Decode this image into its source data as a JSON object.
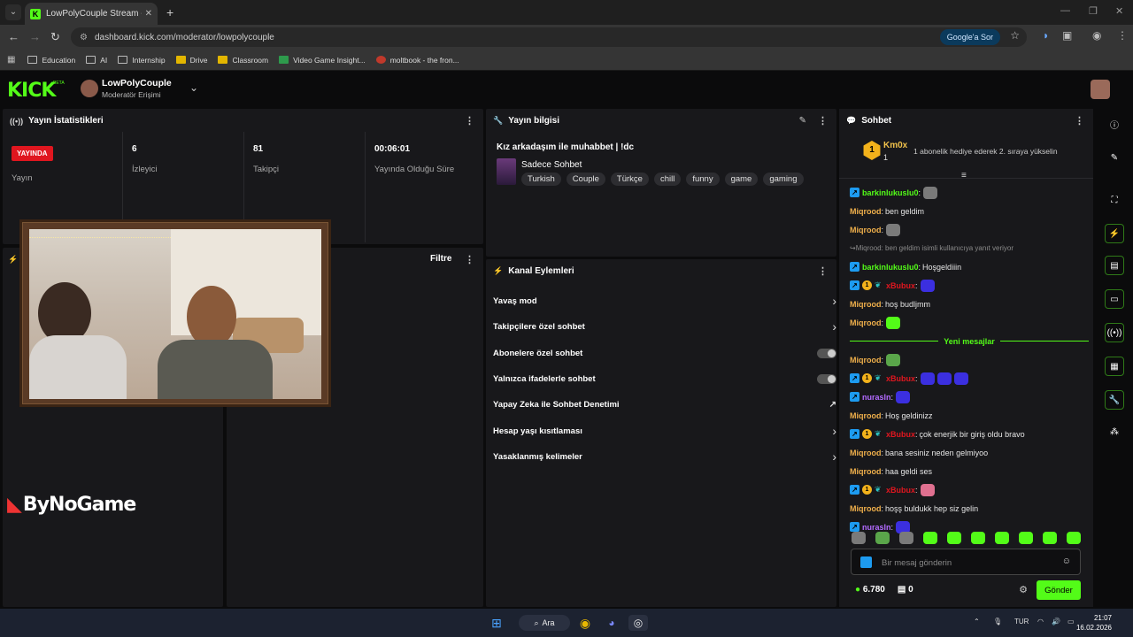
{
  "browser": {
    "tab_title": "LowPolyCouple Stream - Kick D",
    "url": "dashboard.kick.com/moderator/lowpolycouple",
    "google_button": "Google'a Sor",
    "bookmarks": [
      "Education",
      "AI",
      "Internship",
      "Drive",
      "Classroom",
      "Video Game Insight...",
      "moltbook - the fron..."
    ]
  },
  "site": {
    "logo": "KICK",
    "beta": "BETA",
    "channel_name": "LowPolyCouple",
    "channel_role": "Moderatör Erişimi"
  },
  "stats_panel": {
    "title": "Yayın İstatistikleri",
    "live_badge": "YAYINDA",
    "items": [
      {
        "label": "Yayın"
      },
      {
        "value": "6",
        "label": "İzleyici"
      },
      {
        "value": "81",
        "label": "Takipçi"
      },
      {
        "value": "00:06:01",
        "label": "Yayında Olduğu Süre"
      }
    ]
  },
  "activity_panel": {
    "filter": "Filtre"
  },
  "overlay": {
    "sponsor": "ByNoGame"
  },
  "info_panel": {
    "title": "Yayın bilgisi",
    "stream_title": "Kız arkadaşım ile muhabbet | !dc",
    "category": "Sadece Sohbet",
    "tags": [
      "Turkish",
      "Couple",
      "Türkçe",
      "chill",
      "funny",
      "game",
      "gaming"
    ]
  },
  "actions_panel": {
    "title": "Kanal Eylemleri",
    "items": [
      {
        "label": "Yavaş mod",
        "kind": "arrow"
      },
      {
        "label": "Takipçilere özel sohbet",
        "kind": "arrow"
      },
      {
        "label": "Abonelere özel sohbet",
        "kind": "toggle"
      },
      {
        "label": "Yalnızca ifadelerle sohbet",
        "kind": "toggle"
      },
      {
        "label": "Yapay Zeka ile Sohbet Denetimi",
        "kind": "external"
      },
      {
        "label": "Hesap yaşı kısıtlaması",
        "kind": "arrow"
      },
      {
        "label": "Yasaklanmış kelimeler",
        "kind": "arrow"
      }
    ]
  },
  "chat": {
    "title": "Sohbet",
    "highlight": {
      "rank": "1",
      "user": "Km0x",
      "count": "1",
      "message": "1 abonelik hediye ederek 2. sıraya yükselin"
    },
    "messages": [
      {
        "user": "barkinlukuslu0",
        "color": "#53fc18",
        "badges": [
          "kick"
        ],
        "text": "",
        "emotes": [
          "gray"
        ]
      },
      {
        "user": "Miqrood",
        "color": "#f0b04b",
        "badges": [],
        "text": "ben geldim",
        "emotes": []
      },
      {
        "user": "Miqrood",
        "color": "#f0b04b",
        "badges": [],
        "text": "",
        "emotes": [
          "gray"
        ]
      },
      {
        "reply": "Miqrood: ben geldim isimli kullanıcıya yanıt veriyor"
      },
      {
        "user": "barkinlukuslu0",
        "color": "#53fc18",
        "badges": [
          "kick"
        ],
        "text": "Hoşgeldiiin",
        "emotes": []
      },
      {
        "user": "xBubux",
        "color": "#e0161f",
        "badges": [
          "kick",
          "sub",
          "gift"
        ],
        "text": "",
        "emotes": [
          "blue"
        ]
      },
      {
        "user": "Miqrood",
        "color": "#f0b04b",
        "badges": [],
        "text": "hoş budljmm",
        "emotes": []
      },
      {
        "user": "Miqrood",
        "color": "#f0b04b",
        "badges": [],
        "text": "",
        "emotes": [
          "green"
        ]
      },
      {
        "divider": "Yeni mesajlar"
      },
      {
        "user": "Miqrood",
        "color": "#f0b04b",
        "badges": [],
        "text": "",
        "emotes": [
          "frog"
        ]
      },
      {
        "user": "xBubux",
        "color": "#e0161f",
        "badges": [
          "kick",
          "sub",
          "gift"
        ],
        "text": "",
        "emotes": [
          "blue",
          "blue",
          "blue"
        ]
      },
      {
        "user": "nurasln",
        "color": "#b36bff",
        "badges": [
          "kick"
        ],
        "text": "",
        "emotes": [
          "blue"
        ]
      },
      {
        "user": "Miqrood",
        "color": "#f0b04b",
        "badges": [],
        "text": "Hoş geldinizz",
        "emotes": []
      },
      {
        "user": "xBubux",
        "color": "#e0161f",
        "badges": [
          "kick",
          "sub",
          "gift"
        ],
        "text": "çok enerjik bir giriş oldu bravo",
        "emotes": []
      },
      {
        "user": "Miqrood",
        "color": "#f0b04b",
        "badges": [],
        "text": "bana sesiniz neden gelmiyoo",
        "emotes": []
      },
      {
        "user": "Miqrood",
        "color": "#f0b04b",
        "badges": [],
        "text": "haa geldi ses",
        "emotes": []
      },
      {
        "user": "xBubux",
        "color": "#e0161f",
        "badges": [
          "kick",
          "sub",
          "gift"
        ],
        "text": "",
        "emotes": [
          "pink"
        ]
      },
      {
        "user": "Miqrood",
        "color": "#f0b04b",
        "badges": [],
        "text": "hoşş buldukk hep siz gelin",
        "emotes": []
      },
      {
        "user": "nurasln",
        "color": "#b36bff",
        "badges": [
          "kick"
        ],
        "text": "",
        "emotes": [
          "blue"
        ]
      }
    ],
    "placeholder": "Bir mesaj gönderin",
    "points": "6.780",
    "drops": "0",
    "send": "Gönder"
  },
  "taskbar": {
    "search": "Ara",
    "lang": "TUR",
    "time": "21:07",
    "date": "16.02.2026"
  }
}
